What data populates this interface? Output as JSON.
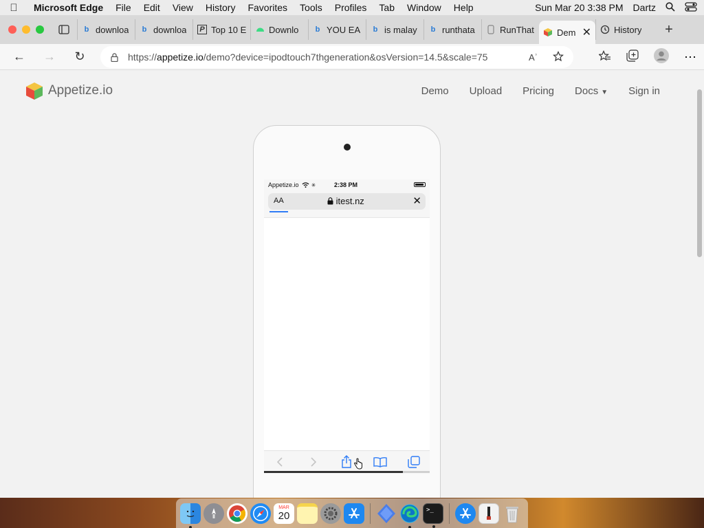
{
  "menubar": {
    "app": "Microsoft Edge",
    "items": [
      "File",
      "Edit",
      "View",
      "History",
      "Favorites",
      "Tools",
      "Profiles",
      "Tab",
      "Window",
      "Help"
    ],
    "datetime": "Sun Mar 20  3:38 PM",
    "user": "Dartz"
  },
  "tabs": [
    {
      "label": "downloa",
      "icon": "bing-icon"
    },
    {
      "label": "downloa",
      "icon": "bing-icon"
    },
    {
      "label": "Top 10 E",
      "icon": "page-icon"
    },
    {
      "label": "Downlo",
      "icon": "android-icon"
    },
    {
      "label": "YOU EA",
      "icon": "bing-icon"
    },
    {
      "label": "is malay",
      "icon": "bing-icon"
    },
    {
      "label": "runthata",
      "icon": "bing-icon"
    },
    {
      "label": "RunThat",
      "icon": "phone-icon"
    }
  ],
  "active_tab": {
    "label": "Dem",
    "icon": "appetize-icon"
  },
  "history_tab": {
    "label": "History"
  },
  "address": {
    "prefix": "https://",
    "domain": "appetize.io",
    "path": "/demo?device=ipodtouch7thgeneration&osVersion=14.5&scale=75",
    "read_aloud": "Aʾ"
  },
  "site": {
    "logo_text": "Appetize.io",
    "nav": [
      "Demo",
      "Upload",
      "Pricing",
      "Docs",
      "Sign in"
    ]
  },
  "device": {
    "carrier": "Appetize.io",
    "time": "2:38 PM",
    "text_size_button": "AA",
    "domain": "itest.nz",
    "page_load_progress": 0.11
  },
  "dock": {
    "calendar_day": "20",
    "calendar_month": "MAR"
  },
  "colors": {
    "accent": "#2f7cf6",
    "bing": "#2a7bd4"
  }
}
